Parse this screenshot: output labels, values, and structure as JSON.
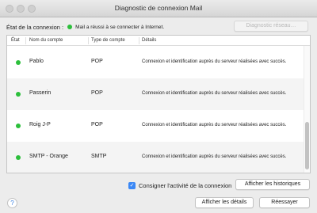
{
  "window": {
    "title": "Diagnostic de connexion Mail"
  },
  "status": {
    "label": "État de la connexion :",
    "text": "Mail a réussi à se connecter à Internet.",
    "color": "#2cbf3b"
  },
  "buttons": {
    "network_diagnostic": "Diagnostic réseau…",
    "show_history": "Afficher les historiques",
    "show_details": "Afficher les détails",
    "retry": "Réessayer"
  },
  "table": {
    "headers": [
      "État",
      "Nom du compte",
      "Type de compte",
      "Détails"
    ],
    "rows": [
      {
        "status": "green",
        "name": "Pablo",
        "type": "POP",
        "details": "Connexion et identification auprès du serveur réalisées avec succès."
      },
      {
        "status": "green",
        "name": "Passerin",
        "type": "POP",
        "details": "Connexion et identification auprès du serveur réalisées avec succès."
      },
      {
        "status": "green",
        "name": "Roig J-P",
        "type": "POP",
        "details": "Connexion et identification auprès du serveur réalisées avec succès."
      },
      {
        "status": "green",
        "name": "SMTP - Orange",
        "type": "SMTP",
        "details": "Connexion et identification auprès du serveur réalisées avec succès."
      }
    ]
  },
  "log_activity": {
    "label": "Consigner l'activité de la connexion",
    "checked": true
  },
  "help": {
    "glyph": "?"
  },
  "colors": {
    "accent": "#3b88f5",
    "success": "#2cbf3b"
  }
}
